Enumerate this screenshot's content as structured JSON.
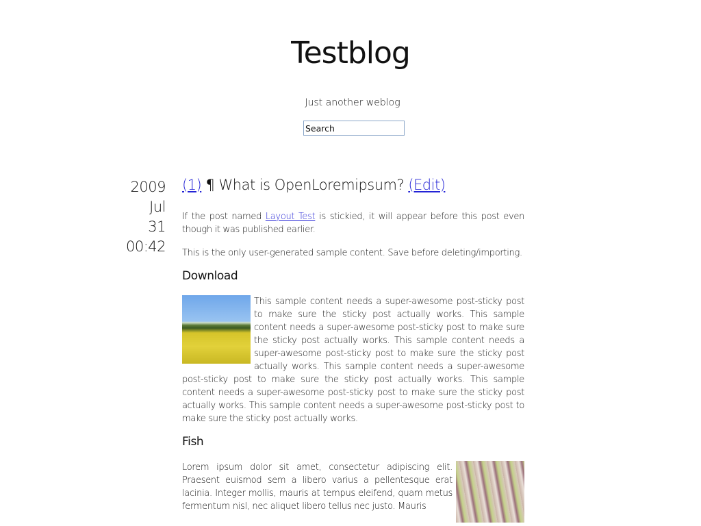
{
  "site": {
    "title": "Testblog",
    "tagline": "Just another weblog",
    "search_placeholder": "Search"
  },
  "post": {
    "date": {
      "year": "2009",
      "month": "Jul",
      "day": "31",
      "time": "00:42"
    },
    "comments_link": "(1)",
    "pilcrow": "¶",
    "title": "What is OpenLoremipsum?",
    "edit_link": "(Edit)",
    "p1_before": "If the post named ",
    "p1_link": "Layout Test",
    "p1_after": " is stickied, it will appear before this post even though it was published earlier.",
    "p2": "This is the only user-generated sample content. Save before deleting/importing.",
    "section1_heading": "Download",
    "section1_text": "This sample content needs a super-awesome post-sticky post to make sure the sticky post actually works. This sample content needs a super-awesome post-sticky post to make sure the sticky post actually works. This sample content needs a super-awesome post-sticky post to make sure the sticky post actually works. This sample content needs a super-awesome post-sticky post to make sure the sticky post actually works. This sample content needs a super-awesome post-sticky post to make sure the sticky post actually works. This sample content needs a super-awesome post-sticky post to make sure the sticky post actually works.",
    "section2_heading": "Fish",
    "section2_text": "Lorem ipsum dolor sit amet, consectetur adipiscing elit. Praesent euismod sem a libero varius a pellentesque erat lacinia. Integer mollis, mauris at tempus eleifend, quam metus fermentum nisl, nec aliquet libero tellus nec justo. Mauris"
  }
}
